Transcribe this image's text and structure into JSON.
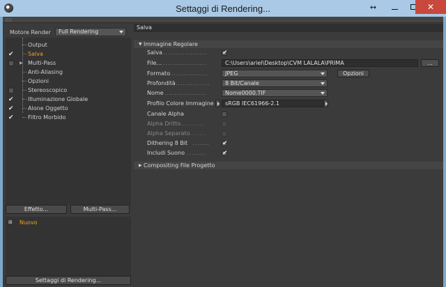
{
  "window": {
    "title": "Settaggi di Rendering...",
    "close_glyph": "✕",
    "resize_glyph": "↔",
    "colors": {
      "accent": "#f2a22a",
      "panel": "#3b3b3b",
      "close": "#c9483d"
    }
  },
  "left": {
    "renderer_label": "Motore Render",
    "renderer_value": "Full Rendering",
    "tree": [
      {
        "label": "Output",
        "checked": false,
        "has_box": false
      },
      {
        "label": "Salva",
        "checked": true,
        "has_box": false,
        "active": true
      },
      {
        "label": "Multi-Pass",
        "checked": false,
        "has_box": true,
        "expander": true
      },
      {
        "label": "Anti-Aliasing",
        "checked": false,
        "has_box": false
      },
      {
        "label": "Opzioni",
        "checked": false,
        "has_box": false
      },
      {
        "label": "Stereoscopico",
        "checked": false,
        "has_box": true
      },
      {
        "label": "Illuminazione Globale",
        "checked": true,
        "has_box": false
      },
      {
        "label": "Alone Oggetto",
        "checked": true,
        "has_box": false
      },
      {
        "label": "Filtro Morbido",
        "checked": true,
        "has_box": false
      }
    ],
    "effects_button": "Effetto...",
    "multipass_button": "Multi-Pass...",
    "preset": "Nuovo",
    "settings_button": "Settaggi di Rendering..."
  },
  "right": {
    "header": "Salva",
    "section_regular": "Immagine Regolare",
    "section_compositing": "Compositing File Progetto",
    "check_glyph": "✔",
    "props": {
      "save": {
        "label": "Salva",
        "checked": true
      },
      "file": {
        "label": "File...",
        "value": "C:\\Users\\ariel\\Desktop\\CVM LALALA\\PRIMA",
        "browse": "..."
      },
      "format": {
        "label": "Formato",
        "value": "JPEG",
        "options_button": "Opzioni"
      },
      "depth": {
        "label": "Profondità",
        "value": "8 Bit/Canale"
      },
      "name": {
        "label": "Nome",
        "value": "Nome0000.TIF"
      },
      "color_profile": {
        "label": "Profilo Colore Immagine",
        "value": "sRGB IEC61966-2.1"
      },
      "alpha_channel": {
        "label": "Canale Alpha",
        "checked": false
      },
      "straight_alpha": {
        "label": "Alpha Dritto",
        "checked": false
      },
      "separate_alpha": {
        "label": "Alpha Separato",
        "checked": false
      },
      "dithering": {
        "label": "Dithering 8 Bit",
        "checked": true
      },
      "include_sound": {
        "label": "Includi Suono",
        "checked": true
      }
    }
  }
}
